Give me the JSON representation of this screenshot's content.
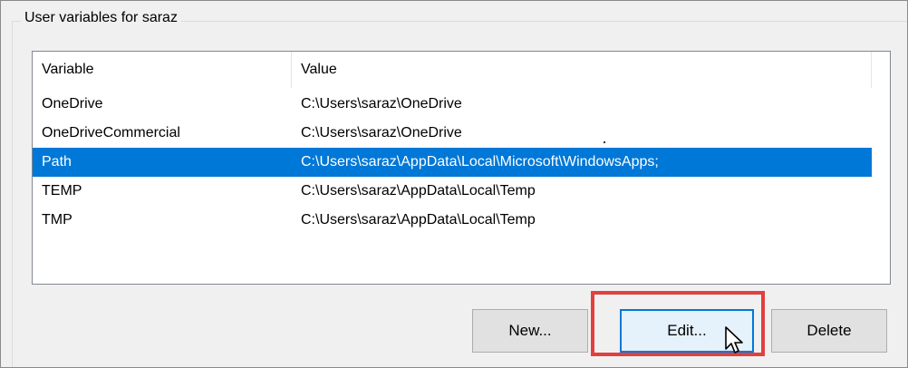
{
  "group": {
    "label": "User variables for saraz"
  },
  "list": {
    "columns": {
      "variable": "Variable",
      "value": "Value"
    },
    "rows": [
      {
        "variable": "OneDrive",
        "value": "C:\\Users\\saraz\\OneDrive",
        "selected": false
      },
      {
        "variable": "OneDriveCommercial",
        "value": "C:\\Users\\saraz\\OneDrive",
        "selected": false
      },
      {
        "variable": "Path",
        "value": "C:\\Users\\saraz\\AppData\\Local\\Microsoft\\WindowsApps;",
        "selected": true
      },
      {
        "variable": "TEMP",
        "value": "C:\\Users\\saraz\\AppData\\Local\\Temp",
        "selected": false
      },
      {
        "variable": "TMP",
        "value": "C:\\Users\\saraz\\AppData\\Local\\Temp",
        "selected": false
      }
    ]
  },
  "buttons": {
    "new_label": "New...",
    "edit_label": "Edit...",
    "delete_label": "Delete"
  },
  "colors": {
    "selection": "#0078d7",
    "highlight_box": "#e04040"
  },
  "icons": {
    "cursor": "mouse-pointer-icon"
  }
}
